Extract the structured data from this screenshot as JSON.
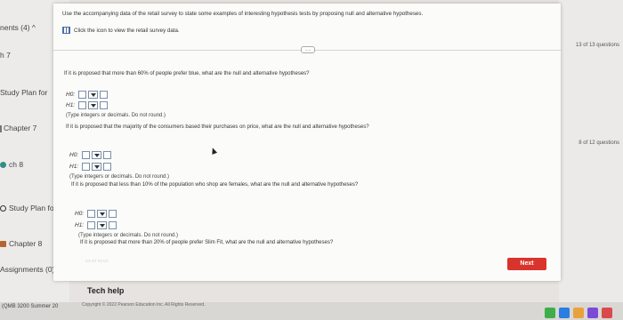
{
  "sidebar": {
    "items": [
      {
        "label": "nents (4)",
        "bullet": "none"
      },
      {
        "label": "h 7",
        "bullet": "none"
      },
      {
        "label": "Study Plan for",
        "bullet": "none"
      },
      {
        "label": "Chapter 7",
        "bullet": "none"
      },
      {
        "label": "ch 8",
        "bullet": "teal-dot"
      },
      {
        "label": "Study Plan for",
        "bullet": "ring"
      },
      {
        "label": "Chapter 8",
        "bullet": "folder"
      },
      {
        "label": "Assignments (0)",
        "bullet": "none"
      },
      {
        "label": "(QMB 3200 Summer 20",
        "bullet": "none"
      }
    ]
  },
  "right_strip": {
    "top_count": "13 of 13 questions",
    "mid_count": "8 of 12 questions"
  },
  "header": {
    "instruction": "Use the accompanying data of the retail survey to state some examples of interesting hypothesis tests by proposing null and alternative hypotheses.",
    "click_text": "Click the icon to view the retail survey data."
  },
  "questions": [
    {
      "prompt": "If it is proposed that more than 60% of people prefer blue, what are the null and alternative hypotheses?",
      "h0_label": "H0:",
      "h1_label": "H1:",
      "note": "(Type integers or decimals. Do not round.)"
    },
    {
      "prompt": "If it is proposed that the majority of the consumers based their purchases on price, what are the null and alternative hypotheses?",
      "h0_label": "H0:",
      "h1_label": "H1:",
      "note": "(Type integers or decimals. Do not round.)"
    },
    {
      "prompt": "If it is proposed that less than 10% of the population who shop are females, what are the null and alternative hypotheses?",
      "h0_label": "H0:",
      "h1_label": "H1:",
      "note": "(Type integers or decimals. Do not round.)"
    },
    {
      "prompt": "If it is proposed that more than 20% of people prefer Slim Fit, what are the null and alternative hypotheses?"
    }
  ],
  "buttons": {
    "next": "Next",
    "collapse": "....."
  },
  "footer": {
    "tech_help": "Tech help",
    "copyright": "Copyright © 2022 Pearson Education Inc. All Rights Reserved."
  },
  "colors": {
    "next_button": "#d9342b",
    "teal": "#2f8f86",
    "folder": "#b5652f"
  }
}
